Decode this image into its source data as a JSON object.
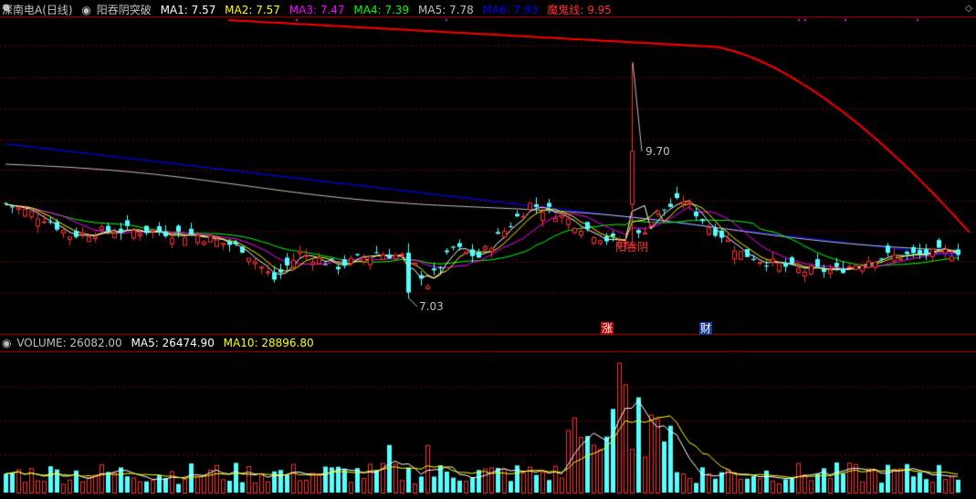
{
  "price_header": {
    "stock_name": "深南电A(日线)",
    "indicator": "阳吞阴突破",
    "ma1": {
      "label": "MA1: 7.57",
      "color": "#ffffff"
    },
    "ma2": {
      "label": "MA2: 7.57",
      "color": "#ffff00"
    },
    "ma3": {
      "label": "MA3: 7.47",
      "color": "#ff00ff"
    },
    "ma4": {
      "label": "MA4: 7.39",
      "color": "#00ff00"
    },
    "ma5": {
      "label": "MA5: 7.78",
      "color": "#c0c0c0"
    },
    "ma6": {
      "label": "MA6: 7.93",
      "color": "#0000ff"
    },
    "demon_line": {
      "label": "魔鬼线: 9.95",
      "color": "#ff0000"
    }
  },
  "volume_header": {
    "volume": {
      "label": "VOLUME: 26082.00",
      "color": "#c0c0c0"
    },
    "ma5": {
      "label": "MA5: 26474.90",
      "color": "#ffffff"
    },
    "ma10": {
      "label": "MA10: 28896.80",
      "color": "#ffff00"
    }
  },
  "annotations": {
    "high_label": "9.70",
    "low_label": "7.03",
    "pattern_label": "阳吞阴",
    "limit_up_marker": "涨",
    "finance_marker": "财"
  },
  "colors": {
    "background": "#000000",
    "up": "#ff3030",
    "down": "#54ffff",
    "grid": "#800000"
  },
  "chart_data": {
    "type": "candlestick",
    "title": "深南电A(日线)",
    "price_range": [
      6.9,
      10.2
    ],
    "high": 9.7,
    "low": 7.03,
    "last_close": 7.57
  }
}
